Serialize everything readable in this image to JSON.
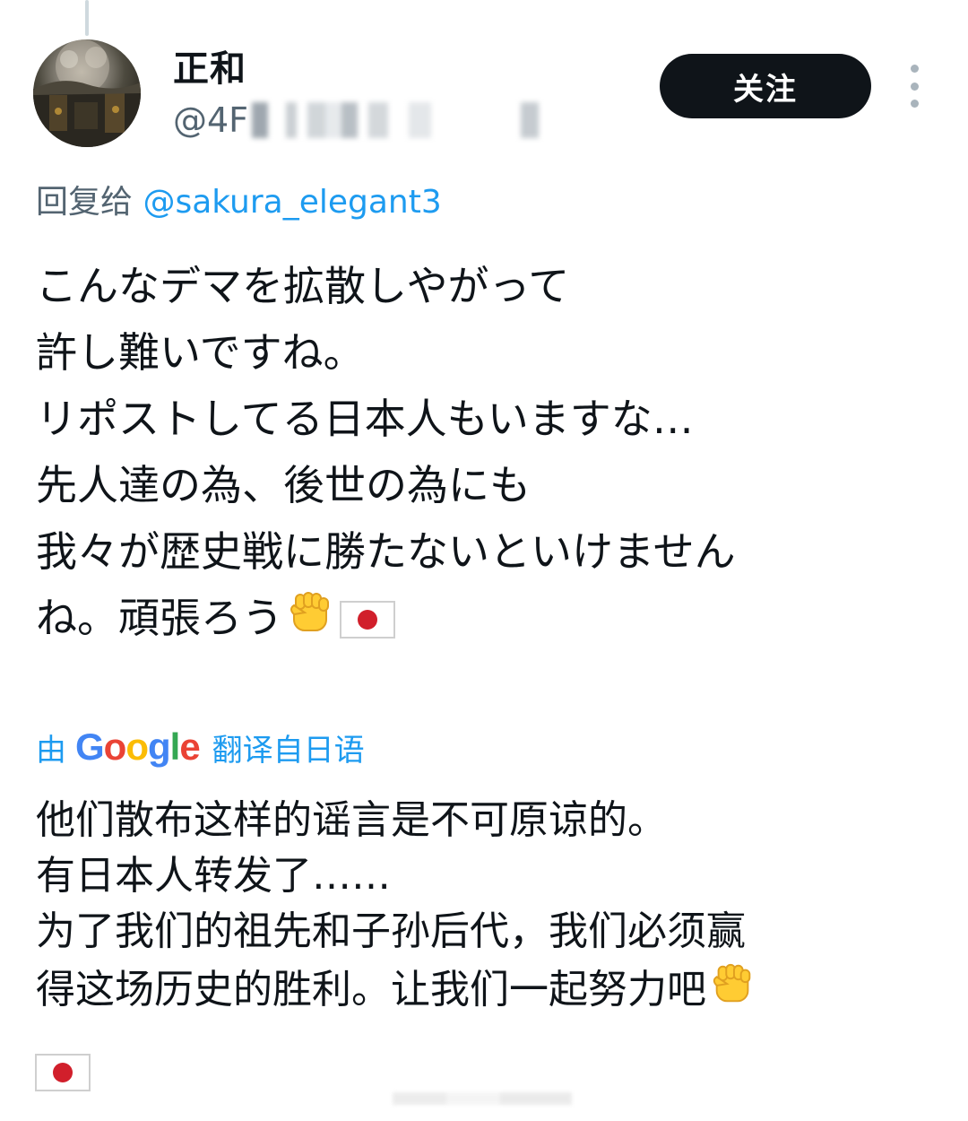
{
  "author": {
    "display_name": "正和",
    "handle_visible": "@4F"
  },
  "follow_button_label": "关注",
  "reply_to": {
    "prefix": "回复给",
    "mention": "@sakura_elegant3"
  },
  "original_text": [
    "こんなデマを拡散しやがって",
    "許し難いですね。",
    "リポストしてる日本人もいますな…",
    "先人達の為、後世の為にも",
    "我々が歴史戦に勝たないといけません",
    "ね。頑張ろう"
  ],
  "translation": {
    "prefix": "由",
    "provider_letters": [
      "G",
      "o",
      "o",
      "g",
      "l",
      "e"
    ],
    "label": "翻译自日语"
  },
  "translated_text": [
    "他们散布这样的谣言是不可原谅的。",
    "有日本人转发了……",
    "为了我们的祖先和子孙后代，我们必须赢",
    "得这场历史的胜利。让我们一起努力吧"
  ],
  "emoji": [
    "raised-fist",
    "japan-flag"
  ],
  "colors": {
    "text": "#0f1419",
    "secondary": "#536471",
    "link": "#1d9bf0",
    "button_bg": "#0f1419",
    "button_text": "#ffffff"
  }
}
